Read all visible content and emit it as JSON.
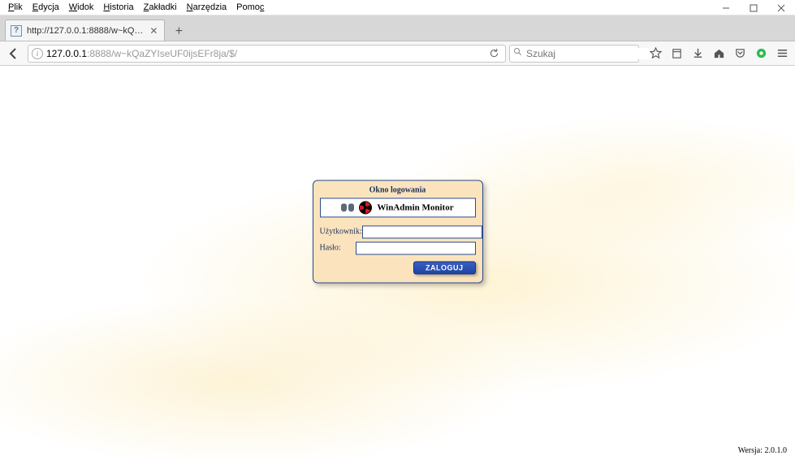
{
  "menu": {
    "file": "Plik",
    "edit": "Edycja",
    "view": "Widok",
    "history": "Historia",
    "bookmarks": "Zakładki",
    "tools": "Narzędzia",
    "help": "Pomoc"
  },
  "tab": {
    "title": "http://127.0.0.1:8888/w~kQ…"
  },
  "address": {
    "host": "127.0.0.1",
    "rest": ":8888/w~kQaZYIseUF0ijsEFr8ja/$/"
  },
  "search": {
    "placeholder": "Szukaj"
  },
  "login": {
    "window_title": "Okno logowania",
    "brand": "WinAdmin Monitor",
    "user_label": "Użytkownik:",
    "pass_label": "Hasło:",
    "user_value": "",
    "pass_value": "",
    "button": "ZALOGUJ"
  },
  "version_label": "Wersja: 2.0.1.0"
}
